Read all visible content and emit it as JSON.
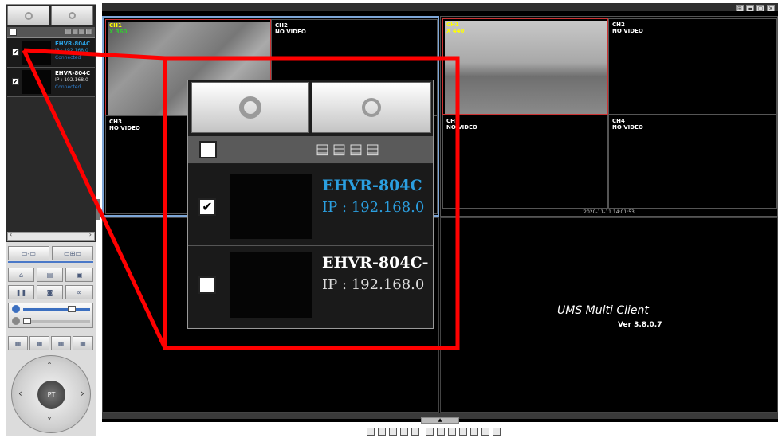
{
  "left_panel": {
    "devices": [
      {
        "name": "EHVR-804C",
        "ip": "IP : 192.168.0",
        "status": "Connected",
        "checked": true
      },
      {
        "name": "EHVR-804C",
        "ip": "IP : 192.168.0",
        "status": "Connected",
        "checked": true
      }
    ],
    "ptz_label": "PT"
  },
  "main": {
    "channels_left": [
      {
        "label": "CH1",
        "sub": "X 360",
        "video": true
      },
      {
        "label": "CH2",
        "sub": "NO VIDEO",
        "video": false
      },
      {
        "label": "CH3",
        "sub": "NO VIDEO",
        "video": false
      }
    ],
    "channels_right": [
      {
        "label": "CH1",
        "sub": "X 440",
        "video": true
      },
      {
        "label": "CH2",
        "sub": "NO VIDEO",
        "video": false
      },
      {
        "label": "CH3",
        "sub": "NO VIDEO",
        "video": false
      },
      {
        "label": "CH4",
        "sub": "NO VIDEO",
        "video": false
      }
    ],
    "timestamp": "2020-11-11 14:01:53",
    "app_title": "UMS Multi Client",
    "app_version": "Ver 3.8.0.7"
  },
  "zoom": {
    "devices": [
      {
        "name": "EHVR-804C",
        "ip": "IP : 192.168.0",
        "checked": true
      },
      {
        "name": "EHVR-804C-",
        "ip": "IP : 192.168.0",
        "checked": false
      }
    ]
  },
  "colors": {
    "accent": "#2b9fe0",
    "highlight": "#ff0000",
    "selected_border": "#7ea7d8"
  }
}
